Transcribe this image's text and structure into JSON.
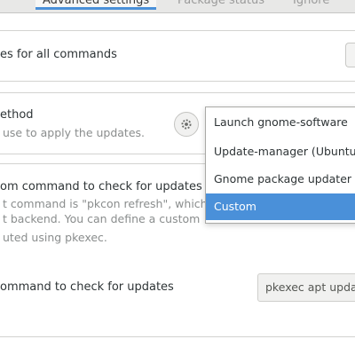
{
  "tabs": [
    {
      "label": "Advanced settings",
      "active": true
    },
    {
      "label": "Package status",
      "active": false
    },
    {
      "label": "Ignore",
      "active": false
    }
  ],
  "settings": {
    "all_commands_label": "es for all commands",
    "method_title": "ethod",
    "method_desc": "use to apply the updates.",
    "custom_title": "om command to check for updates",
    "custom_desc_1": "t command is \"pkcon refresh\", which",
    "custom_desc_2": "t backend. You can define a custom",
    "custom_desc_3": "uted using pkexec.",
    "command_label": "ommand to check for updates",
    "command_value": "pkexec apt update"
  },
  "dropdown": {
    "options": [
      "Launch gnome-software",
      "Update-manager (Ubuntu)",
      "Gnome package updater",
      "Custom"
    ],
    "selected": "Custom"
  },
  "colors": {
    "accent": "#4a90d9",
    "background": "#ffffff",
    "tabbar": "#e8e8e7"
  },
  "icons": {
    "method_button": "gear-icon"
  }
}
